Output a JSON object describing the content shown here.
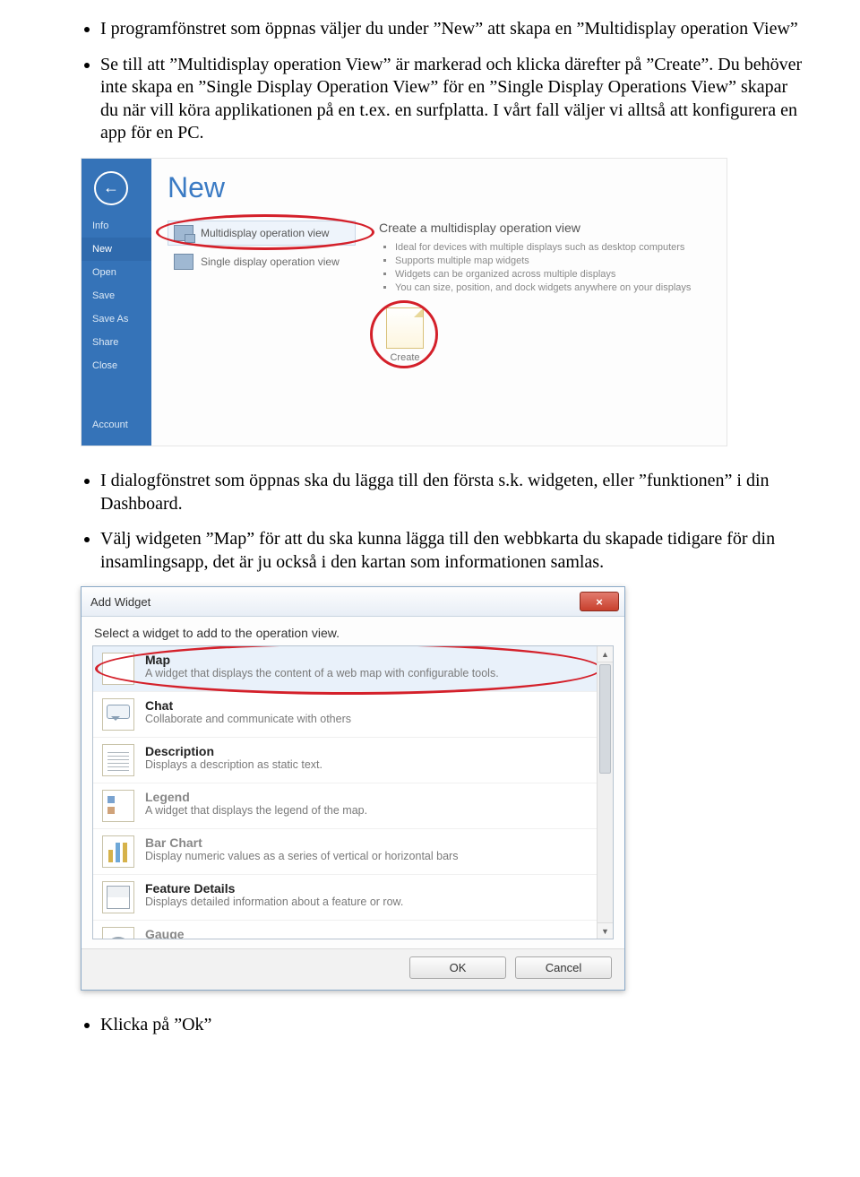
{
  "doc": {
    "p1": "I programfönstret som öppnas väljer du under ”New” att skapa en ”Multidisplay operation View”",
    "p2": "Se till att ”Multidisplay operation View” är markerad och klicka därefter på ”Create”.",
    "p3": "Du behöver inte skapa en ”Single Display Operation View” för en ”Single Display Operations View” skapar du när vill köra applikationen på en t.ex. en surfplatta. I vårt fall väljer vi alltså att konfigurera en app för en PC.",
    "p4": "I dialogfönstret som öppnas ska du lägga till den första s.k. widgeten, eller ”funktionen” i din Dashboard.",
    "p5": "Välj widgeten ”Map” för att du ska kunna lägga till den webbkarta du skapade tidigare för din insamlingsapp, det är ju också i den kartan som informationen samlas.",
    "p6": "Klicka på ”Ok”"
  },
  "shot1": {
    "nav": {
      "back": "←",
      "items": [
        "Info",
        "New",
        "Open",
        "Save",
        "Save As",
        "Share",
        "Close"
      ],
      "account": "Account"
    },
    "title": "New",
    "templates": [
      {
        "label": "Multidisplay operation view",
        "selected": true
      },
      {
        "label": "Single display operation view",
        "selected": false
      }
    ],
    "desc": {
      "heading": "Create a multidisplay operation view",
      "bullets": [
        "Ideal for devices with multiple displays such as desktop computers",
        "Supports multiple map widgets",
        "Widgets can be organized across multiple displays",
        "You can size, position, and dock widgets anywhere on your displays"
      ],
      "create": "Create"
    }
  },
  "shot2": {
    "title": "Add Widget",
    "close": "×",
    "prompt": "Select a widget to add to the operation view.",
    "widgets": [
      {
        "name": "Map",
        "desc": "A widget that displays the content of a web map with configurable tools.",
        "icon": "wi-map",
        "sel": true,
        "ring": true
      },
      {
        "name": "Chat",
        "desc": "Collaborate and communicate with others",
        "icon": "wi-chat"
      },
      {
        "name": "Description",
        "desc": "Displays a description as static text.",
        "icon": "wi-desc"
      },
      {
        "name": "Legend",
        "desc": "A widget that displays the legend of the map.",
        "icon": "wi-legend",
        "dim": true
      },
      {
        "name": "Bar Chart",
        "desc": "Display numeric values as a series of vertical or horizontal bars",
        "icon": "wi-bar",
        "dim": true
      },
      {
        "name": "Feature Details",
        "desc": "Displays detailed information about a feature or row.",
        "icon": "wi-feat"
      },
      {
        "name": "Gauge",
        "desc": "",
        "icon": "wi-gauge",
        "dim": true
      }
    ],
    "ok": "OK",
    "cancel": "Cancel",
    "scroll": {
      "up": "▲",
      "down": "▼"
    }
  }
}
